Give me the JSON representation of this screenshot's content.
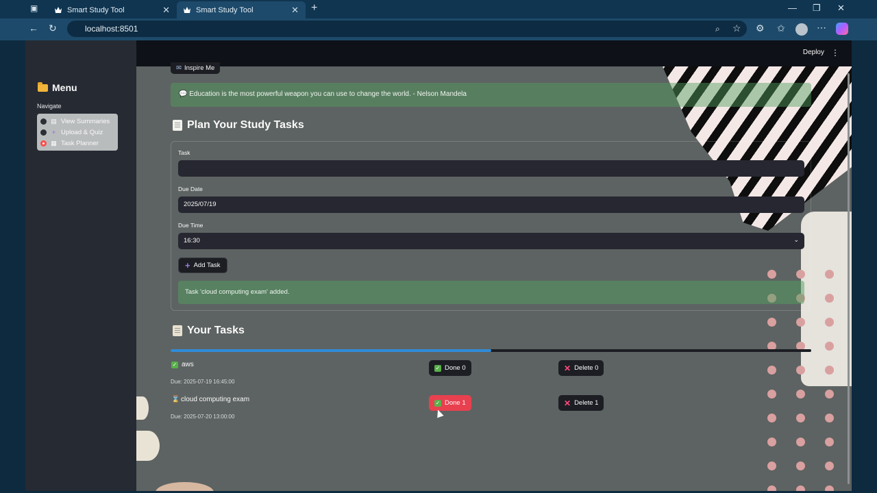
{
  "browser": {
    "tabs": [
      {
        "title": "Smart Study Tool"
      },
      {
        "title": "Smart Study Tool"
      }
    ],
    "url": "localhost:8501"
  },
  "app": {
    "deploy_label": "Deploy",
    "sidebar": {
      "title": "Menu",
      "navigate_label": "Navigate",
      "options": [
        {
          "label": "View Summaries",
          "icon": "page-icon",
          "selected": false
        },
        {
          "label": "Upload & Quiz",
          "icon": "plus-icon",
          "selected": false
        },
        {
          "label": "Task Planner",
          "icon": "calendar-icon",
          "selected": true
        }
      ]
    },
    "inspire_button": "Inspire Me",
    "quote": "Education is the most powerful weapon you can use to change the world. - Nelson Mandela",
    "plan": {
      "heading": "Plan Your Study Tasks",
      "task_label": "Task",
      "task_value": "",
      "due_date_label": "Due Date",
      "due_date_value": "2025/07/19",
      "due_time_label": "Due Time",
      "due_time_value": "16:30",
      "add_button": "Add Task",
      "success_message": "Task 'cloud computing exam' added."
    },
    "tasks": {
      "heading": "Your Tasks",
      "progress": 0.5,
      "items": [
        {
          "status_icon": "check-icon",
          "title": "aws",
          "due": "Due: 2025-07-19 16:45:00",
          "done_label": "Done 0",
          "delete_label": "Delete 0"
        },
        {
          "status_icon": "hourglass-icon",
          "title": "cloud computing exam",
          "due": "Due: 2025-07-20 13:00:00",
          "done_label": "Done 1",
          "delete_label": "Delete 1"
        }
      ]
    }
  },
  "colors": {
    "accent_red": "#e8404f",
    "success_bg": "#52a060",
    "progress": "#2f8bd8"
  }
}
